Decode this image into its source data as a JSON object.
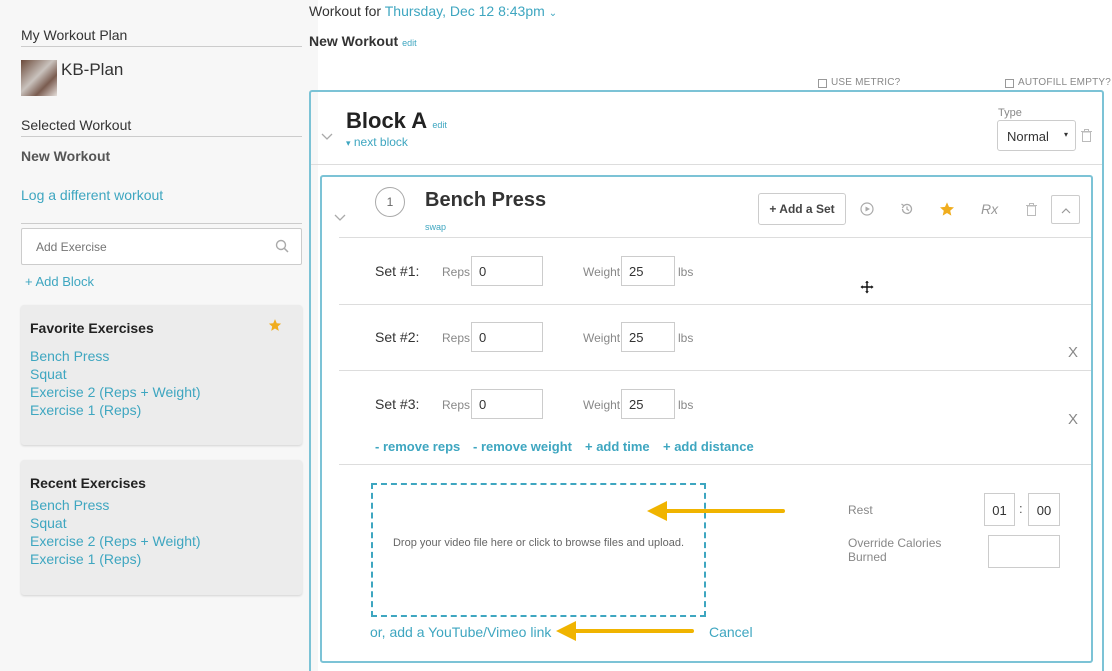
{
  "sidebar": {
    "plan_heading": "My Workout Plan",
    "plan_name": "KB-Plan",
    "selected_heading": "Selected Workout",
    "selected_name": "New Workout",
    "log_link": "Log a different workout",
    "search_placeholder": "Add Exercise",
    "add_block": "+ Add Block",
    "favorites": {
      "title": "Favorite Exercises",
      "items": [
        "Bench Press",
        "Squat",
        "Exercise 2 (Reps + Weight)",
        "Exercise 1 (Reps)"
      ]
    },
    "recent": {
      "title": "Recent Exercises",
      "items": [
        "Bench Press",
        "Squat",
        "Exercise 2 (Reps + Weight)",
        "Exercise 1 (Reps)"
      ]
    }
  },
  "header": {
    "workout_for": "Workout for",
    "date": "Thursday, Dec 12 8:43pm",
    "workout_name": "New Workout",
    "edit": "edit",
    "use_metric": "USE METRIC?",
    "autofill_empty": "AUTOFILL EMPTY?"
  },
  "block": {
    "title": "Block A",
    "edit": "edit",
    "next_block": "next block",
    "type_label": "Type",
    "type_value": "Normal"
  },
  "exercise": {
    "number": "1",
    "name": "Bench Press",
    "swap": "swap",
    "add_set": "+ Add a Set",
    "rx": "Rx",
    "sets": [
      {
        "label": "Set #1:",
        "reps_label": "Reps",
        "reps": "0",
        "weight_label": "Weight",
        "weight": "25",
        "unit": "lbs"
      },
      {
        "label": "Set #2:",
        "reps_label": "Reps",
        "reps": "0",
        "weight_label": "Weight",
        "weight": "25",
        "unit": "lbs",
        "close": "X"
      },
      {
        "label": "Set #3:",
        "reps_label": "Reps",
        "reps": "0",
        "weight_label": "Weight",
        "weight": "25",
        "unit": "lbs",
        "close": "X"
      }
    ],
    "actions": [
      "- remove reps",
      "- remove weight",
      "+ add time",
      "+ add distance"
    ],
    "dropzone_text": "Drop your video file here or click to browse files and upload.",
    "youtube_link": "or, add a YouTube/Vimeo link",
    "cancel": "Cancel",
    "rest_label": "Rest",
    "rest_min": "01",
    "rest_sep": ":",
    "rest_sec": "00",
    "calories_label_1": "Override Calories",
    "calories_label_2": "Burned"
  },
  "colors": {
    "accent": "#3ea6c0",
    "arrow": "#f0b400",
    "star": "#f0ad1e"
  }
}
